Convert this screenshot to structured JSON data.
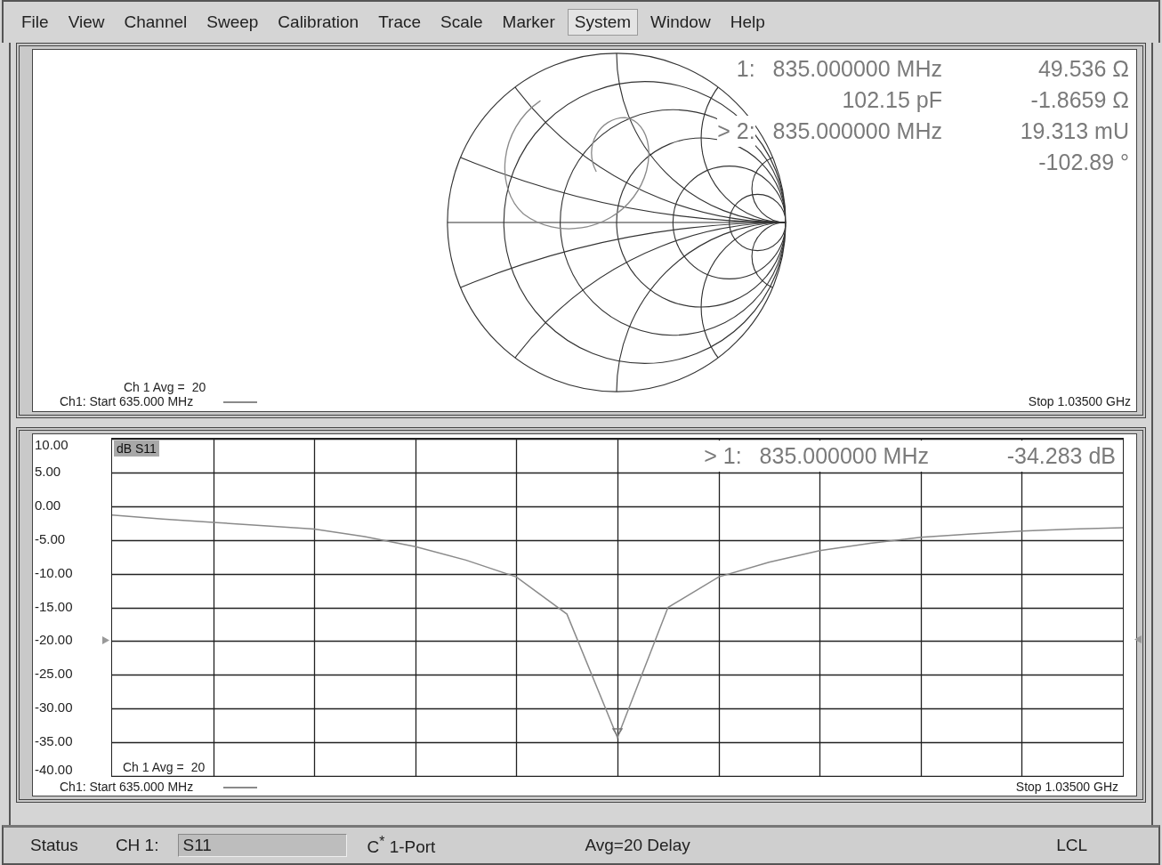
{
  "menu": [
    {
      "label": "File",
      "selected": false
    },
    {
      "label": "View",
      "selected": false
    },
    {
      "label": "Channel",
      "selected": false
    },
    {
      "label": "Sweep",
      "selected": false
    },
    {
      "label": "Calibration",
      "selected": false
    },
    {
      "label": "Trace",
      "selected": false
    },
    {
      "label": "Scale",
      "selected": false
    },
    {
      "label": "Marker",
      "selected": false
    },
    {
      "label": "System",
      "selected": true
    },
    {
      "label": "Window",
      "selected": false
    },
    {
      "label": "Help",
      "selected": false
    }
  ],
  "smith_panel": {
    "readouts": [
      {
        "marker": "1:",
        "reading": "835.000000 MHz",
        "value": "49.536 Ω"
      },
      {
        "reading": "102.15 pF",
        "value": "-1.8659 Ω"
      },
      {
        "marker": "> 2:",
        "reading": "835.000000 MHz",
        "value": "19.313 mU"
      },
      {
        "value": "-102.89 °"
      }
    ],
    "avg_label": "Ch 1 Avg =",
    "avg_value": "20",
    "start": "Ch1: Start 635.000 MHz",
    "stop": "Stop 1.03500 GHz"
  },
  "trace_panel": {
    "trace_label": "dB S11",
    "readout": {
      "marker": "> 1:",
      "reading": "835.000000 MHz",
      "value": "-34.283 dB"
    },
    "chart_data": {
      "type": "line",
      "categories": [
        null,
        null,
        null,
        null,
        null,
        null,
        null,
        null,
        null,
        null,
        null,
        null,
        null,
        null,
        null,
        null,
        null,
        null,
        null,
        null,
        null
      ],
      "series": [
        {
          "color": "#8a8a8a",
          "values": [
            -1.3,
            -1.9,
            -2.4,
            -2.9,
            -3.4,
            -4.5,
            -6,
            -8,
            -10.5,
            -16,
            -34.3,
            -15,
            -10.5,
            -8.3,
            -6.6,
            -5.5,
            -4.6,
            -4.1,
            -3.7,
            -3.4,
            -3.2
          ]
        }
      ],
      "ylim": [
        -40,
        10
      ],
      "grid": true,
      "yticks": [
        {
          "value": 10,
          "label": "10.00"
        },
        {
          "value": 5,
          "label": "5.00"
        },
        {
          "value": 0,
          "label": "0.00"
        },
        {
          "value": -5,
          "label": "-5.00"
        },
        {
          "value": -10,
          "label": "-10.00"
        },
        {
          "value": -15,
          "label": "-15.00"
        },
        {
          "value": -20,
          "label": "-20.00"
        },
        {
          "value": -25,
          "label": "-25.00"
        },
        {
          "value": -30,
          "label": "-30.00"
        },
        {
          "value": -35,
          "label": "-35.00"
        },
        {
          "value": -40,
          "label": "-40.00"
        }
      ]
    },
    "avg_label": "Ch 1 Avg =",
    "avg_value": "20",
    "start": "Ch1: Start 635.000 MHz",
    "stop": "Stop 1.03500 GHz"
  },
  "status_bar": {
    "title": "Status",
    "channel": "CH 1:",
    "parameter": "S11",
    "calibration": "C$^{*}$ 1-Port",
    "averaging": "Avg=20 Delay",
    "mode": "LCL"
  }
}
